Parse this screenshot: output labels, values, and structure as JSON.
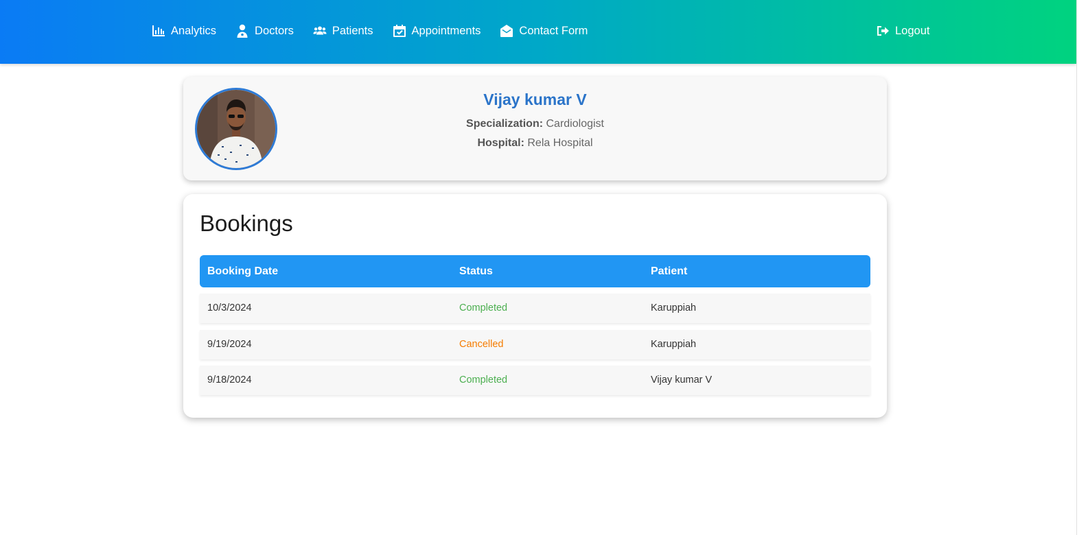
{
  "nav": {
    "items": [
      {
        "label": "Analytics",
        "icon": "chart-bar-icon"
      },
      {
        "label": "Doctors",
        "icon": "user-doctor-icon"
      },
      {
        "label": "Patients",
        "icon": "users-icon"
      },
      {
        "label": "Appointments",
        "icon": "calendar-check-icon"
      },
      {
        "label": "Contact Form",
        "icon": "envelope-open-icon"
      }
    ],
    "logout": {
      "label": "Logout",
      "icon": "sign-out-icon"
    }
  },
  "profile": {
    "name": "Vijay kumar V",
    "specialization_label": "Specialization:",
    "specialization": "Cardiologist",
    "hospital_label": "Hospital:",
    "hospital": "Rela Hospital"
  },
  "bookings": {
    "title": "Bookings",
    "columns": [
      "Booking Date",
      "Status",
      "Patient"
    ],
    "rows": [
      {
        "date": "10/3/2024",
        "status": "Completed",
        "patient": "Karuppiah"
      },
      {
        "date": "9/19/2024",
        "status": "Cancelled",
        "patient": "Karuppiah"
      },
      {
        "date": "9/18/2024",
        "status": "Completed",
        "patient": "Vijay kumar V"
      }
    ]
  },
  "colors": {
    "nav_gradient_start": "#0a7bf5",
    "nav_gradient_end": "#00d37f",
    "table_header": "#2196f3",
    "doctor_name": "#2b74c9",
    "status_completed": "#4caf50",
    "status_cancelled": "#f57c00"
  }
}
